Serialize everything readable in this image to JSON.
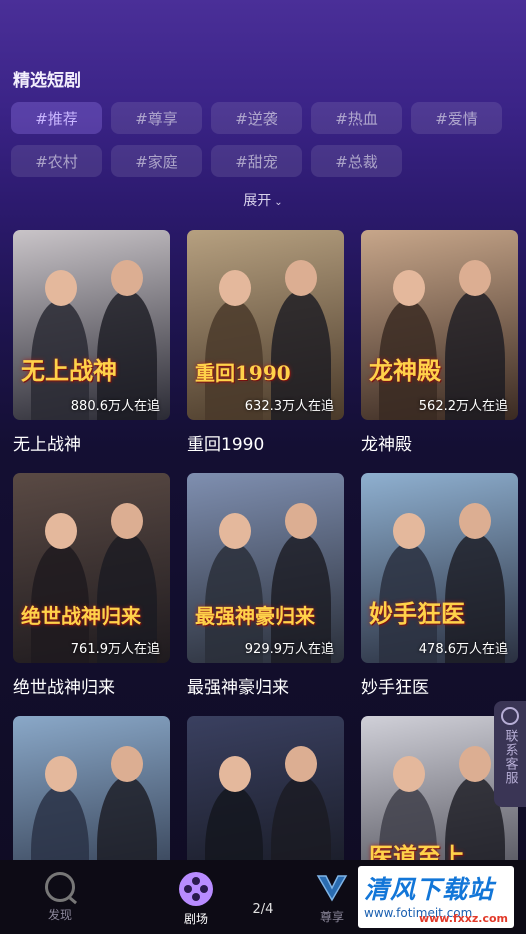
{
  "section": {
    "title": "精选短剧"
  },
  "tags": [
    "#推荐",
    "#尊享",
    "#逆袭",
    "#热血",
    "#爱情",
    "#农村",
    "#家庭",
    "#甜宠",
    "#总裁"
  ],
  "active_tag_index": 0,
  "expand_label": "展开",
  "dramas": [
    {
      "title": "无上战神",
      "views": "880.6万人在追",
      "poster_text": "无上战神",
      "colors": [
        "#c9c4c8",
        "#2a2a34"
      ]
    },
    {
      "title": "重回1990",
      "views": "632.3万人在追",
      "poster_text": "重回1990",
      "colors": [
        "#b6a080",
        "#4a3a2a"
      ]
    },
    {
      "title": "龙神殿",
      "views": "562.2万人在追",
      "poster_text": "龙神殿",
      "colors": [
        "#c7a68a",
        "#3a2a22"
      ]
    },
    {
      "title": "绝世战神归来",
      "views": "761.9万人在追",
      "poster_text": "绝世战神归来",
      "colors": [
        "#5a4a44",
        "#1e1a1e"
      ]
    },
    {
      "title": "最强神豪归来",
      "views": "929.9万人在追",
      "poster_text": "最强神豪归来",
      "colors": [
        "#7f8fb0",
        "#2a2f3a"
      ]
    },
    {
      "title": "妙手狂医",
      "views": "478.6万人在追",
      "poster_text": "妙手狂医",
      "colors": [
        "#8fb0d0",
        "#2a3040"
      ]
    },
    {
      "title": "",
      "views": "",
      "poster_text": "",
      "colors": [
        "#8aa8c8",
        "#2a3346"
      ]
    },
    {
      "title": "",
      "views": "",
      "poster_text": "",
      "colors": [
        "#3a4060",
        "#14161e"
      ]
    },
    {
      "title": "",
      "views": "",
      "poster_text": "医道至上",
      "colors": [
        "#d0d0d8",
        "#40404a"
      ]
    }
  ],
  "contact": {
    "label": "联系客服"
  },
  "tabbar": {
    "items": [
      {
        "label": "发现",
        "icon": "discover-icon",
        "active": false
      },
      {
        "label": "剧场",
        "icon": "theater-icon",
        "active": true
      },
      {
        "label": "尊享",
        "icon": "vip-icon",
        "active": false
      }
    ],
    "pager": "2/4"
  },
  "watermark": {
    "main": "清风下载站",
    "sub": "www.fxxz.com",
    "url": "www.fotimeit.com"
  },
  "colors": {
    "accent": "#b88cff",
    "tag_active_text": "#c9b6ff"
  }
}
